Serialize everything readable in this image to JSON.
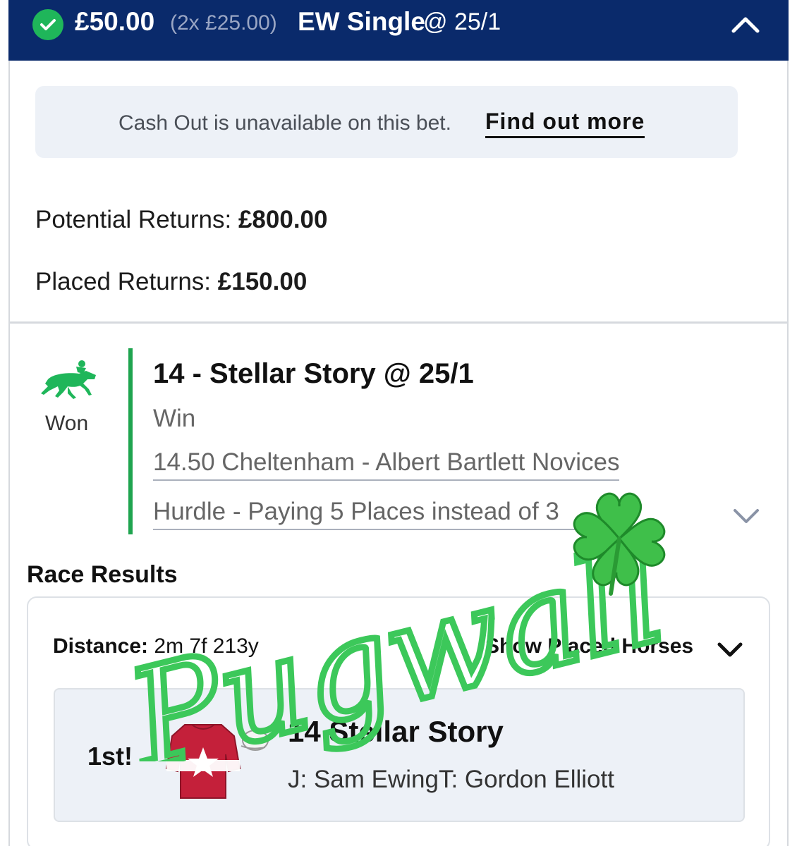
{
  "header": {
    "stake": "£50.00",
    "split": "(2x £25.00)",
    "bet_type": "EW Single",
    "odds": "@ 25/1",
    "status_icon": "check-circle-icon",
    "collapse_icon": "chevron-up-icon",
    "bg_color": "#0a2a6b"
  },
  "notice": {
    "text": "Cash Out is unavailable on this bet.",
    "link": "Find out more"
  },
  "returns": {
    "potential_label": "Potential Returns:",
    "potential_value": "£800.00",
    "placed_label": "Placed Returns:",
    "placed_value": "£150.00"
  },
  "selection": {
    "status_icon": "racehorse-icon",
    "status": "Won",
    "title": "14 - Stellar Story @ 25/1",
    "market": "Win",
    "race_line1": "14.50 Cheltenham - Albert Bartlett Novices",
    "race_line2": "Hurdle - Paying 5 Places instead of 3",
    "expand_icon": "chevron-down-icon",
    "accent_color": "#1fa44f"
  },
  "race_results": {
    "title": "Race Results",
    "distance_label": "Distance:",
    "distance_value": "2m 7f 213y",
    "show_placed": "Show Placed Horses",
    "show_placed_icon": "chevron-down-icon",
    "result": {
      "position": "1st!",
      "horse": "14 Stellar Story",
      "people": "J: Sam EwingT: Gordon Elliott",
      "silks_icon": "jockey-silks-icon",
      "cap_icon": "jockey-cap-icon"
    }
  },
  "overlay": {
    "watermark": "Pugwall",
    "clover_icon": "four-leaf-clover-icon",
    "color": "#3cc85a"
  }
}
